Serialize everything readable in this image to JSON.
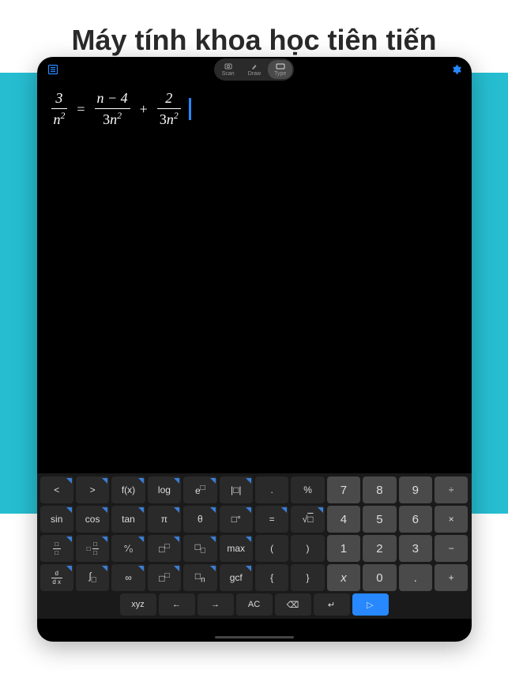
{
  "hero": {
    "title": "Máy tính khoa học tiên tiến"
  },
  "modes": {
    "scan": "Scan",
    "draw": "Draw",
    "type": "Type"
  },
  "equation": {
    "f1_num": "3",
    "f1_den_base": "n",
    "f1_den_exp": "2",
    "eq": "=",
    "f2_num": "n − 4",
    "f2_den_coef": "3",
    "f2_den_base": "n",
    "f2_den_exp": "2",
    "plus": "+",
    "f3_num": "2",
    "f3_den_coef": "3",
    "f3_den_base": "n",
    "f3_den_exp": "2"
  },
  "keys": {
    "r1": {
      "k1": "<",
      "k2": ">",
      "k3": "f(x)",
      "k4": "log",
      "k6": "|□|",
      "k7": ".",
      "k8": "%",
      "n7": "7",
      "n8": "8",
      "n9": "9",
      "div": "÷"
    },
    "r1_e": {
      "base": "e",
      "exp": "□"
    },
    "r2": {
      "k1": "sin",
      "k2": "cos",
      "k3": "tan",
      "k4": "π",
      "k5": "θ",
      "k6": "□°",
      "k7": "=",
      "n4": "4",
      "n5": "5",
      "n6": "6",
      "mul": "×"
    },
    "r2_sqrt": {
      "sym": "√",
      "box": "□"
    },
    "r3": {
      "k3": "°⁄₀",
      "k6": "max",
      "k7": "(",
      "k8": ")",
      "n1": "1",
      "n2": "2",
      "n3": "3",
      "sub": "−"
    },
    "r3_frac": {
      "t": "□",
      "b": "□"
    },
    "r3_mix": {
      "w": "□",
      "t": "□",
      "b": "□"
    },
    "r3_exp": {
      "base": "□",
      "exp": "□"
    },
    "r3_sub": {
      "base": "□",
      "sub": "□"
    },
    "r4": {
      "k3": "∞",
      "k6": "gcf",
      "k7": "{",
      "k8": "}",
      "nx": "x",
      "n0": "0",
      "nd": ".",
      "add": "+"
    },
    "r4_deriv": {
      "t": "d",
      "b": "d x"
    },
    "r4_int": {
      "s": "∫",
      "b": "□"
    },
    "r4_pow": {
      "base": "□",
      "exp": "□"
    },
    "r4_subn": {
      "base": "□",
      "sub": "n"
    },
    "bottom": {
      "xyz": "xyz",
      "left": "←",
      "right": "→",
      "ac": "AC",
      "back": "⌫",
      "enter": "↵",
      "send": "▷"
    }
  }
}
